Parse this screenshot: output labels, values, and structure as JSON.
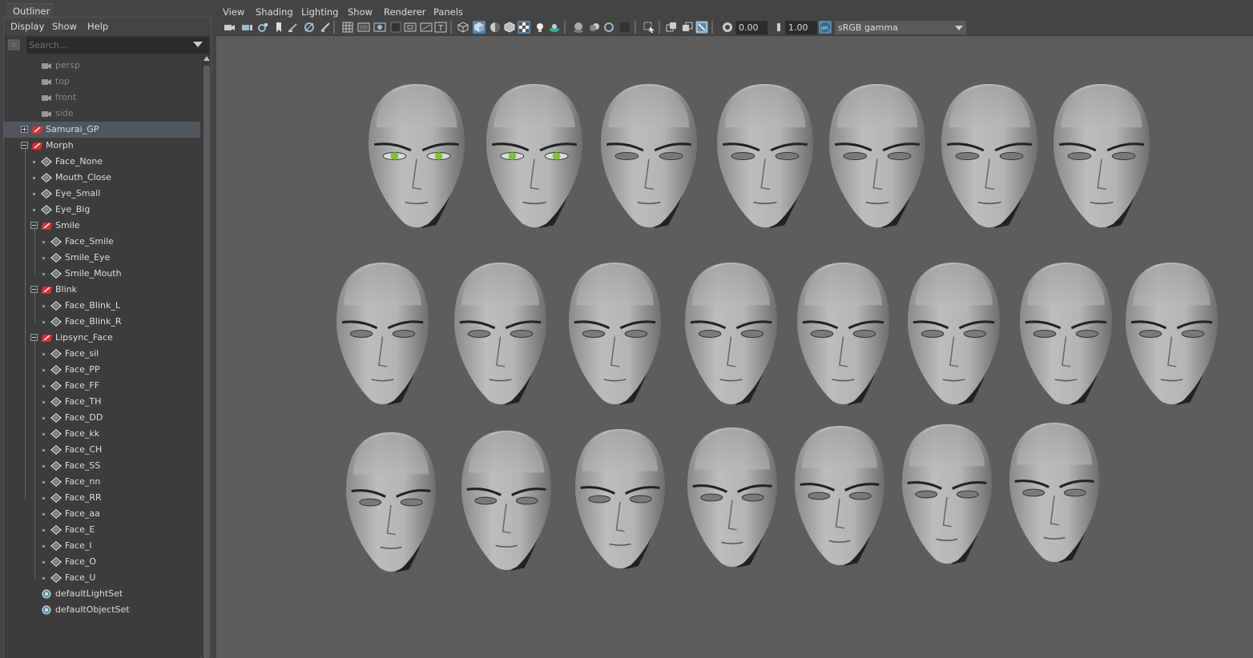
{
  "outliner": {
    "tab_label": "Outliner",
    "menu": [
      "Display",
      "Show",
      "Help"
    ],
    "search_placeholder": "Search...",
    "items": [
      {
        "label": "persp",
        "kind": "camera",
        "depth": 0
      },
      {
        "label": "top",
        "kind": "camera",
        "depth": 0
      },
      {
        "label": "front",
        "kind": "camera",
        "depth": 0
      },
      {
        "label": "side",
        "kind": "camera",
        "depth": 0
      },
      {
        "label": "Samurai_GP",
        "kind": "group",
        "depth": 0,
        "expander": "plus",
        "selected": true
      },
      {
        "label": "Morph",
        "kind": "group",
        "depth": 0,
        "expander": "minus"
      },
      {
        "label": "Face_None",
        "kind": "mesh",
        "depth": 1
      },
      {
        "label": "Mouth_Close",
        "kind": "mesh",
        "depth": 1
      },
      {
        "label": "Eye_Small",
        "kind": "mesh",
        "depth": 1
      },
      {
        "label": "Eye_Big",
        "kind": "mesh",
        "depth": 1
      },
      {
        "label": "Smile",
        "kind": "group",
        "depth": 1,
        "expander": "minus"
      },
      {
        "label": "Face_Smile",
        "kind": "mesh",
        "depth": 2
      },
      {
        "label": "Smile_Eye",
        "kind": "mesh",
        "depth": 2
      },
      {
        "label": "Smile_Mouth",
        "kind": "mesh",
        "depth": 2
      },
      {
        "label": "Blink",
        "kind": "group",
        "depth": 1,
        "expander": "minus"
      },
      {
        "label": "Face_Blink_L",
        "kind": "mesh",
        "depth": 2
      },
      {
        "label": "Face_Blink_R",
        "kind": "mesh",
        "depth": 2
      },
      {
        "label": "Lipsync_Face",
        "kind": "group",
        "depth": 1,
        "expander": "minus"
      },
      {
        "label": "Face_sil",
        "kind": "mesh",
        "depth": 2
      },
      {
        "label": "Face_PP",
        "kind": "mesh",
        "depth": 2
      },
      {
        "label": "Face_FF",
        "kind": "mesh",
        "depth": 2
      },
      {
        "label": "Face_TH",
        "kind": "mesh",
        "depth": 2
      },
      {
        "label": "Face_DD",
        "kind": "mesh",
        "depth": 2
      },
      {
        "label": "Face_kk",
        "kind": "mesh",
        "depth": 2
      },
      {
        "label": "Face_CH",
        "kind": "mesh",
        "depth": 2
      },
      {
        "label": "Face_SS",
        "kind": "mesh",
        "depth": 2
      },
      {
        "label": "Face_nn",
        "kind": "mesh",
        "depth": 2
      },
      {
        "label": "Face_RR",
        "kind": "mesh",
        "depth": 2
      },
      {
        "label": "Face_aa",
        "kind": "mesh",
        "depth": 2
      },
      {
        "label": "Face_E",
        "kind": "mesh",
        "depth": 2
      },
      {
        "label": "Face_I",
        "kind": "mesh",
        "depth": 2
      },
      {
        "label": "Face_O",
        "kind": "mesh",
        "depth": 2
      },
      {
        "label": "Face_U",
        "kind": "mesh",
        "depth": 2
      },
      {
        "label": "defaultLightSet",
        "kind": "set",
        "depth": 0
      },
      {
        "label": "defaultObjectSet",
        "kind": "set",
        "depth": 0
      }
    ]
  },
  "viewport": {
    "menu": [
      "View",
      "Shading",
      "Lighting",
      "Show",
      "Renderer",
      "Panels"
    ],
    "exposure": "0.00",
    "gamma": "1.00",
    "color_space": "sRGB gamma",
    "face_rows": [
      7,
      8,
      7
    ]
  },
  "colors": {
    "selection": "#52565c",
    "toolbar_active": "#5a86a8",
    "canvas_bg": "#5d5d5d",
    "eye_green": "#7fc23a"
  }
}
